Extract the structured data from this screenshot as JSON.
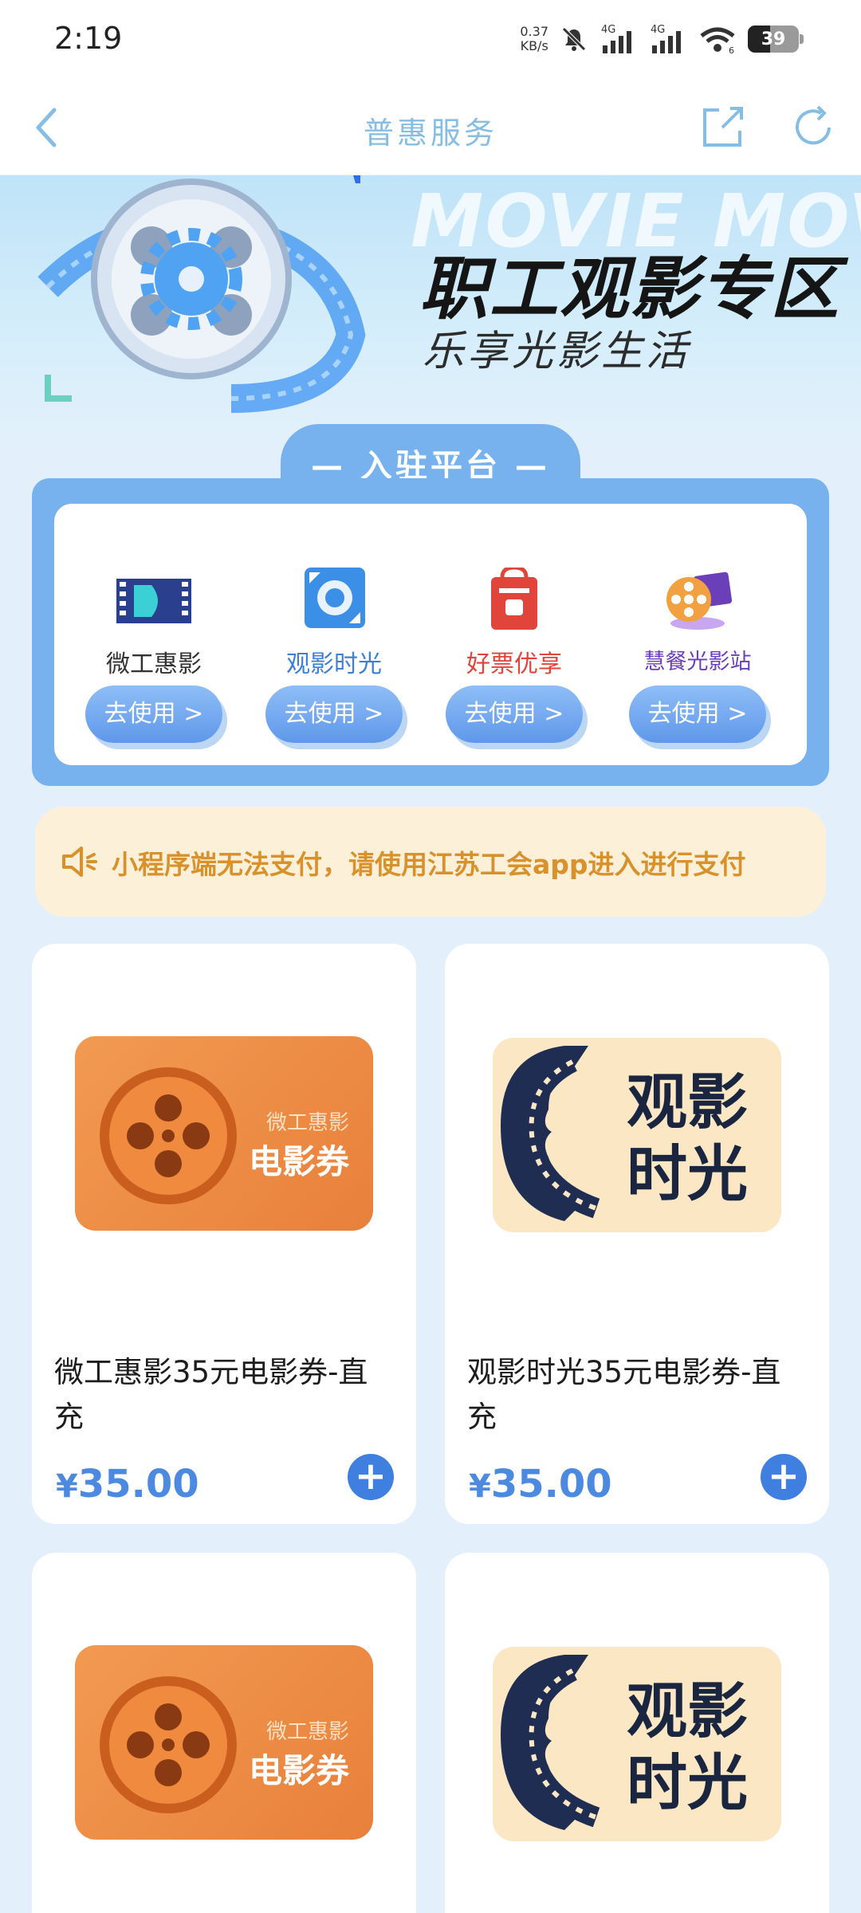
{
  "status_bar": {
    "time": "2:19",
    "net_speed_value": "0.37",
    "net_speed_unit": "KB/s",
    "sim1": "4G",
    "sim2": "4G",
    "wifi_num": "6",
    "battery": "39"
  },
  "navbar": {
    "title": "普惠服务",
    "icons": [
      "back-icon",
      "share-icon",
      "refresh-icon"
    ]
  },
  "hero": {
    "watermark": "MOVIE MOVIE",
    "title": "职工观影专区",
    "subtitle": "乐享光影生活"
  },
  "platform": {
    "section_label": "— 入驻平台 —",
    "items": [
      {
        "name": "微工惠影",
        "button": "去使用 >",
        "name_color": "#333333"
      },
      {
        "name": "观影时光",
        "button": "去使用 >",
        "name_color": "#3b7fd6"
      },
      {
        "name": "好票优享",
        "button": "去使用 >",
        "name_color": "#e0443a"
      },
      {
        "name": "慧餐光影站",
        "button": "去使用 >",
        "name_color": "#6a3fb8"
      }
    ]
  },
  "notice": {
    "text": "小程序端无法支付，请使用江苏工会app进入进行支付",
    "icon": "speaker-icon"
  },
  "products": [
    {
      "image_sub": "微工惠影",
      "image_main": "电影券",
      "title": "微工惠影35元电影券-直充",
      "currency": "¥",
      "price": "35.00"
    },
    {
      "image_text_line1": "观影",
      "image_text_line2": "时光",
      "title": "观影时光35元电影券-直充",
      "currency": "¥",
      "price": "35.00"
    },
    {
      "image_sub": "微工惠影",
      "image_main": "电影券"
    },
    {
      "image_text_line1": "观影",
      "image_text_line2": "时光"
    }
  ],
  "colors": {
    "accent": "#4b8ae0",
    "platform_bg": "#77b2ef",
    "notice_text": "#d9912c"
  }
}
